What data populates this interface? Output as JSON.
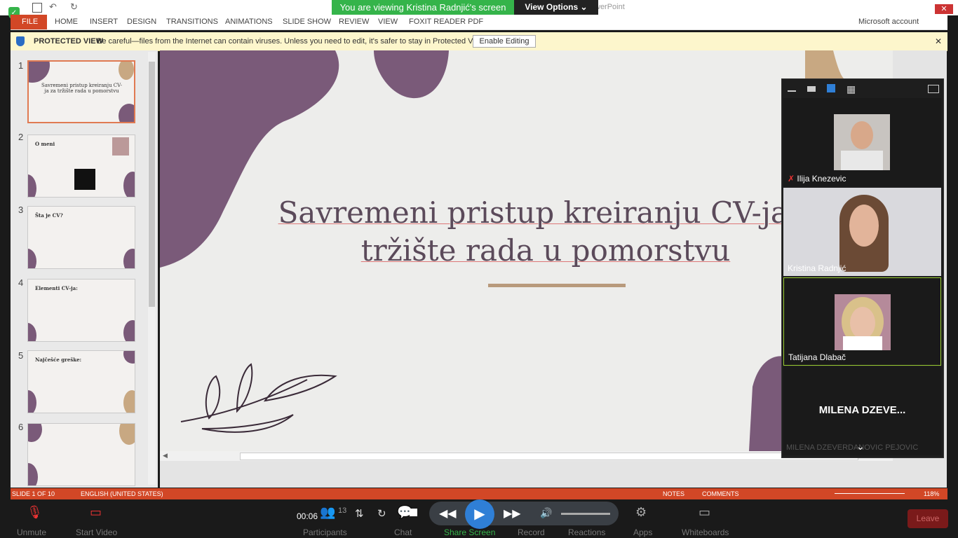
{
  "window": {
    "app_title": "werPoint",
    "account": "Microsoft account"
  },
  "ribbon": {
    "tabs": [
      "FILE",
      "HOME",
      "INSERT",
      "DESIGN",
      "TRANSITIONS",
      "ANIMATIONS",
      "SLIDE SHOW",
      "REVIEW",
      "VIEW",
      "FOXIT READER PDF"
    ]
  },
  "share": {
    "banner": "You are viewing Kristina Radnjić's screen",
    "view_options": "View Options"
  },
  "protected_view": {
    "label": "PROTECTED VIEW",
    "message": "Be careful—files from the Internet can contain viruses. Unless you need to edit, it's safer to stay in Protected View.",
    "button": "Enable Editing"
  },
  "thumbnails": [
    {
      "num": "1",
      "title": "Savremeni pristup kreiranju CV-ja za tržište rada u pomorstvu"
    },
    {
      "num": "2",
      "title": "O meni"
    },
    {
      "num": "3",
      "title": "Šta je CV?"
    },
    {
      "num": "4",
      "title": "Elementi CV-ja:"
    },
    {
      "num": "5",
      "title": "Najčešće greške:"
    },
    {
      "num": "6",
      "title": ""
    }
  ],
  "slide": {
    "title_line1": "Savremeni pristup kreiranju CV-ja z",
    "title_line2": "tržište rada u pomorstvu"
  },
  "participants": [
    {
      "name": "Ilija Knezevic",
      "muted": true
    },
    {
      "name": "Kristina Radnjić"
    },
    {
      "name": "Tatijana Dlabač"
    },
    {
      "name": "MILENA DZEVE..."
    }
  ],
  "participant_overflow": "MILENA DZEVERDANOVIC PEJOVIC",
  "status": {
    "slide": "SLIDE 1 OF 10",
    "language": "ENGLISH (UNITED STATES)",
    "notes": "NOTES",
    "comments": "COMMENTS",
    "zoom": "118%"
  },
  "toolbar": {
    "unmute": "Unmute",
    "start_video": "Start Video",
    "participants": "Participants",
    "participants_count": "13",
    "chat": "Chat",
    "share_screen": "Share Screen",
    "record": "Record",
    "reactions": "Reactions",
    "apps": "Apps",
    "whiteboards": "Whiteboards",
    "leave": "Leave",
    "elapsed": "00:06"
  },
  "colors": {
    "accent": "#d24726",
    "slide_plum": "#7a5a79",
    "slide_tan": "#c8a882",
    "zoom_green": "#35b44a"
  }
}
